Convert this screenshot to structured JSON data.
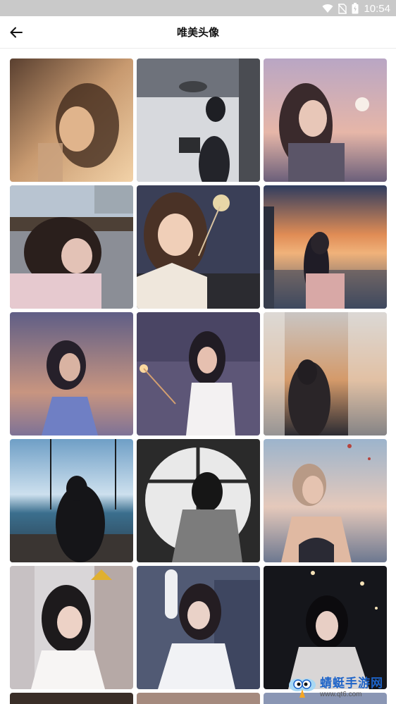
{
  "status_bar": {
    "time": "10:54"
  },
  "header": {
    "title": "唯美头像"
  },
  "gallery": {
    "images": [
      {
        "subject": "portrait-warm-sunlight"
      },
      {
        "subject": "girl-with-book-zen-garden"
      },
      {
        "subject": "girl-with-sparkler-dusk"
      },
      {
        "subject": "girl-resting-city-terrace"
      },
      {
        "subject": "girl-with-sparkler-night"
      },
      {
        "subject": "girl-phone-sunset-sea"
      },
      {
        "subject": "girl-blue-shirt-dusk"
      },
      {
        "subject": "girl-sparkler-white-tee"
      },
      {
        "subject": "girl-curtains-sunset"
      },
      {
        "subject": "silhouette-swing-seaside"
      },
      {
        "subject": "bw-round-window"
      },
      {
        "subject": "girl-balloons-sunset"
      },
      {
        "subject": "girl-white-shirt-street"
      },
      {
        "subject": "girl-car-seat"
      },
      {
        "subject": "girl-night-street-lights"
      }
    ]
  },
  "watermark": {
    "title": "蜻蜓手游网",
    "url": "www.qt6.com"
  },
  "colors": {
    "status_bar": "#c9c9c9",
    "accent": "#1d63c8"
  }
}
